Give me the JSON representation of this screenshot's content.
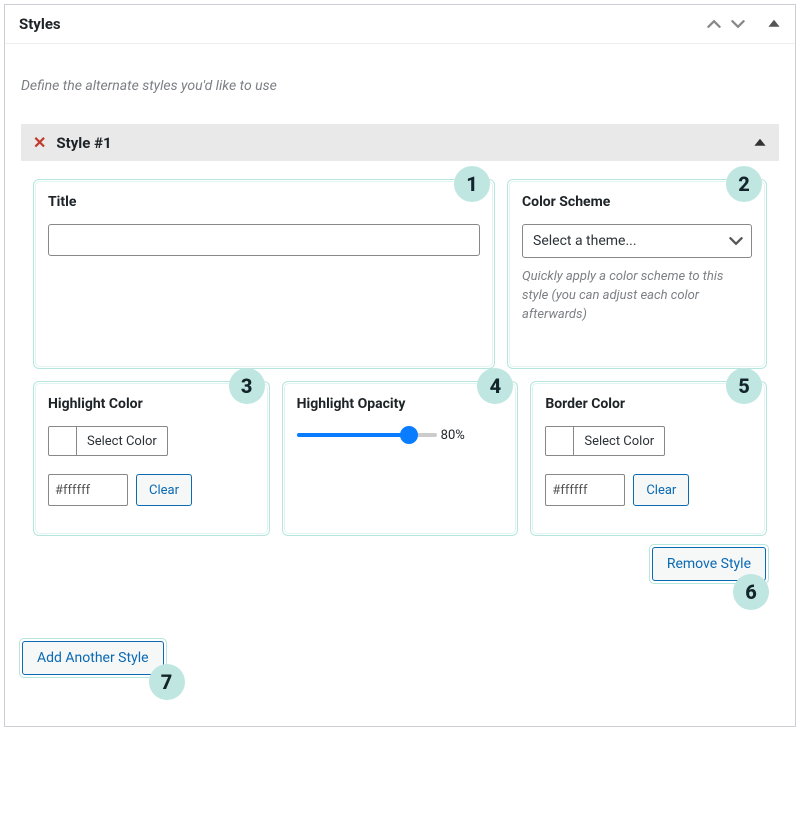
{
  "panel": {
    "title": "Styles",
    "intro": "Define the alternate styles you'd like to use"
  },
  "style": {
    "name": "Style #1",
    "title_label": "Title",
    "title_value": "",
    "scheme_label": "Color Scheme",
    "scheme_placeholder": "Select a theme...",
    "scheme_hint": "Quickly apply a color scheme to this style (you can adjust each color afterwards)",
    "highlight_color_label": "Highlight Color",
    "highlight_opacity_label": "Highlight Opacity",
    "border_color_label": "Border Color",
    "select_color_label": "Select Color",
    "hex_value": "#ffffff",
    "clear_label": "Clear",
    "opacity_value": "80%",
    "opacity_percent": 80,
    "remove_label": "Remove Style"
  },
  "actions": {
    "add_another": "Add Another Style"
  },
  "badges": [
    "1",
    "2",
    "3",
    "4",
    "5",
    "6",
    "7"
  ]
}
